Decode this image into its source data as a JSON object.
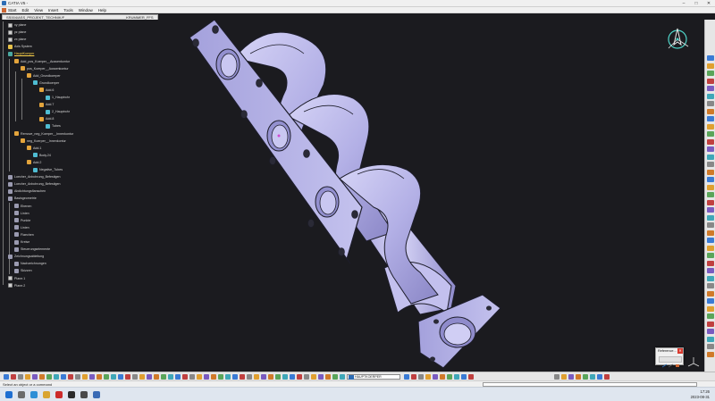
{
  "window": {
    "title": "CATIA V5 -",
    "controls": [
      "–",
      "□",
      "✕"
    ]
  },
  "menu": {
    "items": [
      "Start",
      "Edit",
      "View",
      "Insert",
      "Tools",
      "Window",
      "Help"
    ]
  },
  "document_tab": {
    "label": "SS004/ASS_PROJEKT_TECHNIK/F_______________________________KRUMMER_FFS"
  },
  "spec_tree": {
    "nodes": [
      {
        "label": "xy plane",
        "icon": "plane-icon"
      },
      {
        "label": "yz plane",
        "icon": "plane-icon"
      },
      {
        "label": "zx plane",
        "icon": "plane-icon"
      },
      {
        "label": "Axis System",
        "icon": "axis-system-icon"
      },
      {
        "label": "HauptKoerper",
        "icon": "part-body-icon",
        "highlight": true
      },
      {
        "label": "Add_pos_Koerper__Aussenkontur",
        "icon": "body-icon"
      },
      {
        "label": "pos_Koerper__Aussenkontur",
        "icon": "body-icon"
      },
      {
        "label": "Add_Grundkoerper",
        "icon": "body-icon"
      },
      {
        "label": "Grundkoerper",
        "icon": "feature-icon"
      },
      {
        "label": "Add.6",
        "icon": "body-icon"
      },
      {
        "label": "1_Hauptrohr",
        "icon": "feature-icon"
      },
      {
        "label": "Add.7",
        "icon": "body-icon"
      },
      {
        "label": "2_Hauptrohr",
        "icon": "feature-icon"
      },
      {
        "label": "Add.8",
        "icon": "body-icon"
      },
      {
        "label": "Tubes",
        "icon": "feature-icon"
      },
      {
        "label": "Remove_neg_Koerper__Innenkontur",
        "icon": "body-icon"
      },
      {
        "label": "neg_Koerper__Innenkontur",
        "icon": "body-icon"
      },
      {
        "label": "Add.1",
        "icon": "body-icon"
      },
      {
        "label": "Body.24",
        "icon": "feature-icon"
      },
      {
        "label": "Add.2",
        "icon": "body-icon"
      },
      {
        "label": "Negative_Tubes",
        "icon": "feature-icon"
      },
      {
        "label": "Loecher_Anbohrung_Befestigen",
        "icon": "geometry-icon"
      },
      {
        "label": "Loecher_Anbohrung_Befestigen",
        "icon": "geometry-icon"
      },
      {
        "label": "Abdichtungsflanschen",
        "icon": "geometry-icon"
      },
      {
        "label": "Basisgeometrie",
        "icon": "geometry-icon"
      },
      {
        "label": "Ebenen",
        "icon": "geometry-icon"
      },
      {
        "label": "Linien",
        "icon": "geometry-icon"
      },
      {
        "label": "Punkte",
        "icon": "geometry-icon"
      },
      {
        "label": "Linien",
        "icon": "geometry-icon"
      },
      {
        "label": "Flaechen",
        "icon": "geometry-icon"
      },
      {
        "label": "Kreise",
        "icon": "geometry-icon"
      },
      {
        "label": "Steuerungselemente",
        "icon": "geometry-icon"
      },
      {
        "label": "Zeichnungsableitung",
        "icon": "geometry-icon"
      },
      {
        "label": "Nachzeichnungen",
        "icon": "geometry-icon"
      },
      {
        "label": "Skizzen",
        "icon": "geometry-icon"
      },
      {
        "label": "Plane.1",
        "icon": "plane-icon"
      },
      {
        "label": "Plane.2",
        "icon": "plane-icon"
      }
    ]
  },
  "bottom_toolbar": {
    "body_selector": "HAUPTKOERPER"
  },
  "status_bar": {
    "message": "Select an object or a command"
  },
  "reference_dialog": {
    "title": "Reference..."
  },
  "taskbar": {
    "time": "17:26",
    "date": "2023-08-31"
  },
  "colors": {
    "background": "#1b1b1f",
    "part_fill": "#b6b3e8",
    "part_edge": "#1d1d2a",
    "tree_highlight": "#ffd54a"
  }
}
